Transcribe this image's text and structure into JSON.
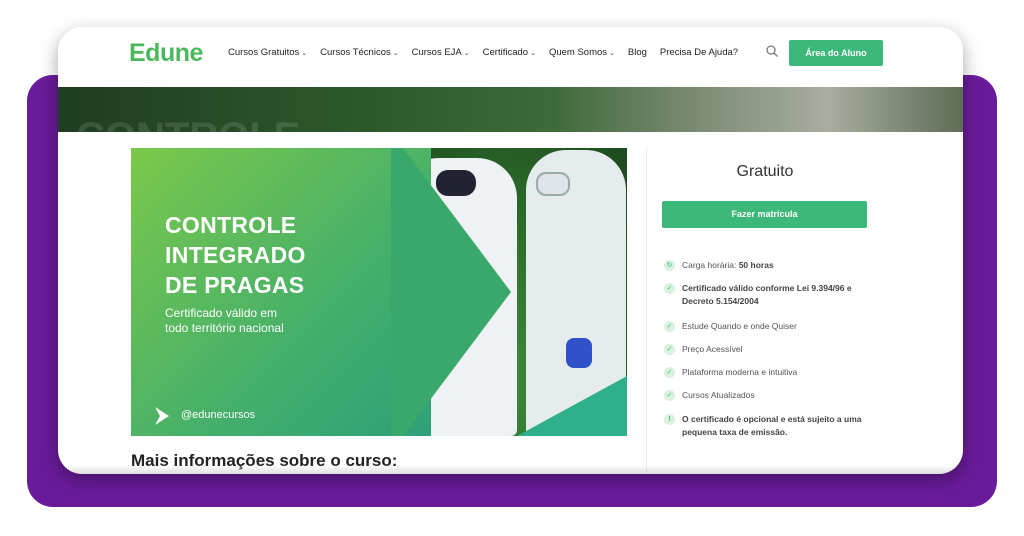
{
  "header": {
    "logo": "Edune",
    "nav": [
      {
        "label": "Cursos Gratuitos",
        "dropdown": true
      },
      {
        "label": "Cursos Técnicos",
        "dropdown": true
      },
      {
        "label": "Cursos EJA",
        "dropdown": true
      },
      {
        "label": "Certificado",
        "dropdown": true
      },
      {
        "label": "Quem Somos",
        "dropdown": true
      },
      {
        "label": "Blog",
        "dropdown": false
      },
      {
        "label": "Precisa De Ajuda?",
        "dropdown": false
      }
    ],
    "student_area": "Área do Aluno"
  },
  "course_image": {
    "title_lines": [
      "CONTROLE",
      "INTEGRADO",
      "DE PRAGAS"
    ],
    "subtitle_lines": [
      "Certificado válido em",
      "todo território nacional"
    ],
    "handle": "@edunecursos"
  },
  "more_info": "Mais informações sobre o curso:",
  "sidebar": {
    "price": "Gratuito",
    "enroll": "Fazer matrícula",
    "features": [
      {
        "icon": "clock-icon",
        "text": "Carga horária: ",
        "bold": "50 horas"
      },
      {
        "icon": "check-icon",
        "text": "",
        "bold": "Certificado válido conforme Lei 9.394/96 e Decreto 5.154/2004"
      },
      {
        "icon": "check-icon",
        "text": "Estude Quando e onde Quiser",
        "bold": ""
      },
      {
        "icon": "check-icon",
        "text": "Preço Acessível",
        "bold": ""
      },
      {
        "icon": "check-icon",
        "text": "Plataforma moderna e intuitiva",
        "bold": ""
      },
      {
        "icon": "check-icon",
        "text": "Cursos Atualizados",
        "bold": ""
      },
      {
        "icon": "exclamation-icon",
        "text": "",
        "bold": "O certificado é opcional e está sujeito a uma pequena taxa de emissão."
      }
    ]
  },
  "colors": {
    "brand_green": "#4cb85c",
    "button_green": "#3cb878",
    "frame_purple": "#6a1b9a"
  }
}
